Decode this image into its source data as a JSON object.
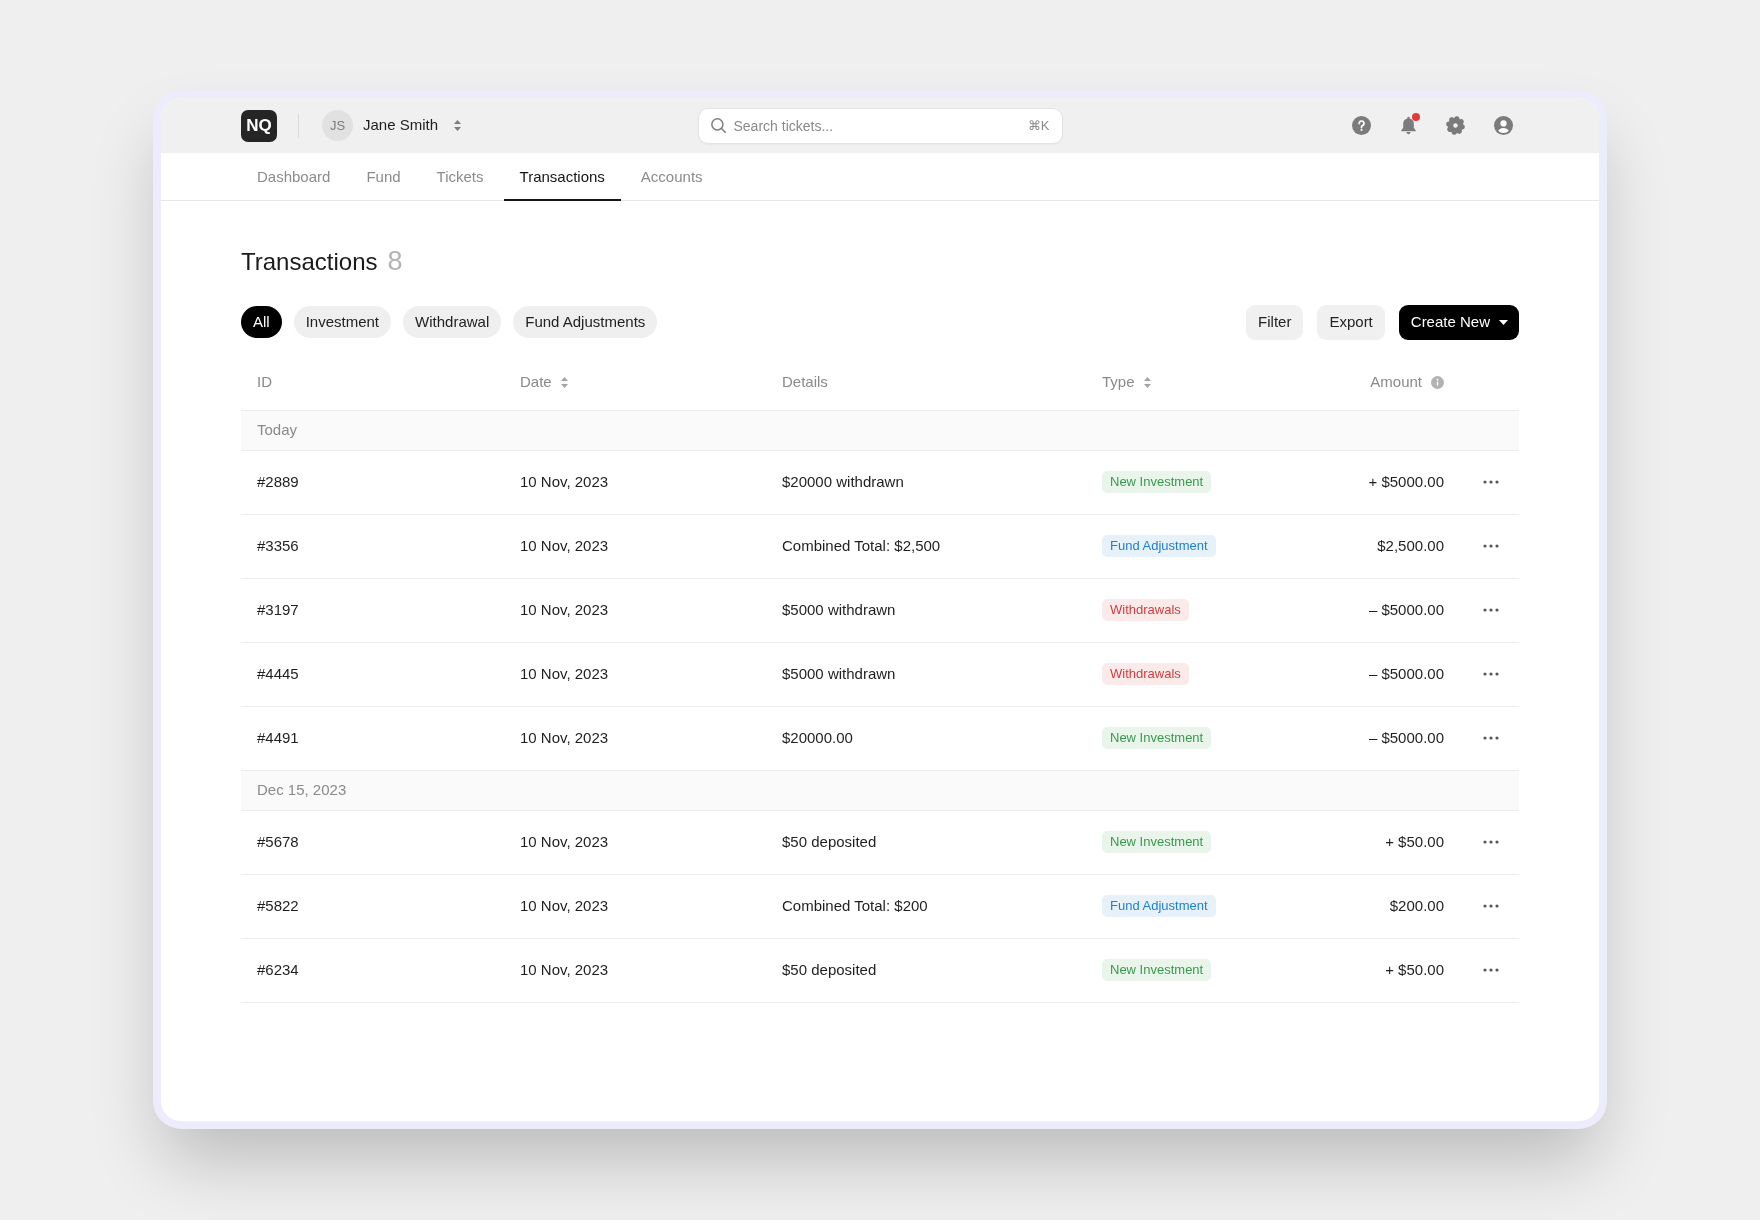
{
  "header": {
    "logo": "NQ",
    "user": {
      "initials": "JS",
      "name": "Jane Smith"
    },
    "search": {
      "placeholder": "Search tickets...",
      "shortcut": "⌘K"
    },
    "notifications": {
      "unread": true
    }
  },
  "nav_tabs": [
    {
      "label": "Dashboard",
      "selected": false
    },
    {
      "label": "Fund",
      "selected": false
    },
    {
      "label": "Tickets",
      "selected": false
    },
    {
      "label": "Transactions",
      "selected": true
    },
    {
      "label": "Accounts",
      "selected": false
    }
  ],
  "page": {
    "title": "Transactions",
    "count": "8"
  },
  "filters": [
    {
      "label": "All",
      "selected": true
    },
    {
      "label": "Investment",
      "selected": false
    },
    {
      "label": "Withdrawal",
      "selected": false
    },
    {
      "label": "Fund Adjustments",
      "selected": false
    }
  ],
  "actions": [
    {
      "label": "Filter",
      "kind": "plain"
    },
    {
      "label": "Export",
      "kind": "plain"
    },
    {
      "label": "Create New",
      "kind": "menu"
    }
  ],
  "table": {
    "columns": [
      {
        "label": "ID",
        "sortable": false,
        "info": false
      },
      {
        "label": "Date",
        "sortable": true,
        "info": false
      },
      {
        "label": "Details",
        "sortable": false,
        "info": false
      },
      {
        "label": "Type",
        "sortable": true,
        "info": false
      },
      {
        "label": "Amount",
        "sortable": false,
        "info": true
      }
    ],
    "groups": [
      {
        "label": "Today",
        "rows": [
          {
            "id": "#2889",
            "date": "10 Nov, 2023",
            "details": "$20000 withdrawn",
            "type": {
              "label": "New Investment",
              "color": "#3a9a4c"
            },
            "amount": "+ $5000.00"
          },
          {
            "id": "#3356",
            "date": "10 Nov, 2023",
            "details": "Combined Total: $2,500",
            "type": {
              "label": "Fund Adjustment",
              "color": "#1f7fd6"
            },
            "amount": "$2,500.00"
          },
          {
            "id": "#3197",
            "date": "10 Nov, 2023",
            "details": "$5000 withdrawn",
            "type": {
              "label": "Withdrawals",
              "color": "#d63c3c"
            },
            "amount": "– $5000.00"
          },
          {
            "id": "#4445",
            "date": "10 Nov, 2023",
            "details": "$5000 withdrawn",
            "type": {
              "label": "Withdrawals",
              "color": "#d63c3c"
            },
            "amount": "– $5000.00"
          },
          {
            "id": "#4491",
            "date": "10 Nov, 2023",
            "details": "$20000.00",
            "type": {
              "label": "New Investment",
              "color": "#3a9a4c"
            },
            "amount": "– $5000.00"
          }
        ]
      },
      {
        "label": "Dec 15, 2023",
        "rows": [
          {
            "id": "#5678",
            "date": "10 Nov, 2023",
            "details": "$50 deposited",
            "type": {
              "label": "New Investment",
              "color": "#3a9a4c"
            },
            "amount": "+ $50.00"
          },
          {
            "id": "#5822",
            "date": "10 Nov, 2023",
            "details": "Combined Total: $200",
            "type": {
              "label": "Fund Adjustment",
              "color": "#1f7fd6"
            },
            "amount": "$200.00"
          },
          {
            "id": "#6234",
            "date": "10 Nov, 2023",
            "details": "$50 deposited",
            "type": {
              "label": "New Investment",
              "color": "#3a9a4c"
            },
            "amount": "+ $50.00"
          }
        ]
      }
    ]
  }
}
